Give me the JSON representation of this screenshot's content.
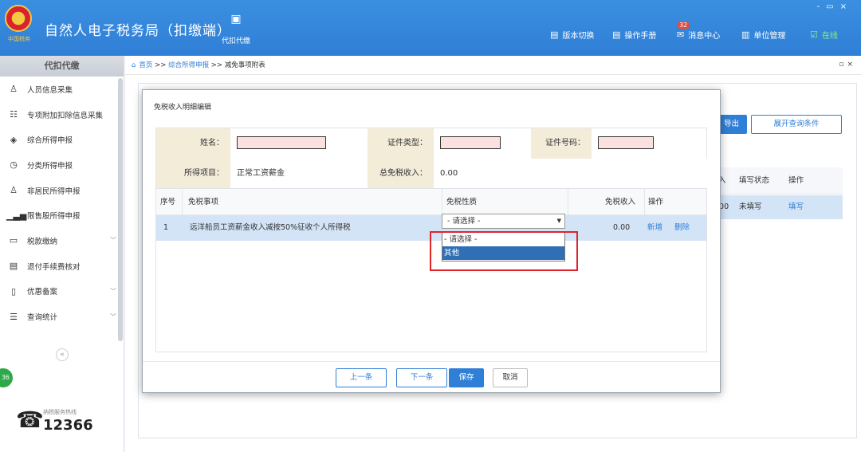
{
  "app": {
    "title": "自然人电子税务局（扣缴端）",
    "emblem_text": "中国税务",
    "top_tool": {
      "label": "代扣代缴",
      "icon": "wallet-icon"
    },
    "nav": [
      {
        "label": "版本切换",
        "icon": "document-icon"
      },
      {
        "label": "操作手册",
        "icon": "document-icon"
      },
      {
        "label": "消息中心",
        "icon": "mail-icon",
        "badge": "32"
      },
      {
        "label": "单位管理",
        "icon": "building-icon"
      },
      {
        "label": "在线",
        "icon": "online-icon"
      }
    ],
    "window_controls": [
      "-",
      "▭",
      "×"
    ]
  },
  "sidebar": {
    "title": "代扣代缴",
    "items": [
      {
        "label": "人员信息采集",
        "icon": "person-icon"
      },
      {
        "label": "专项附加扣除信息采集",
        "icon": "list-icon"
      },
      {
        "label": "综合所得申报",
        "icon": "layers-icon"
      },
      {
        "label": "分类所得申报",
        "icon": "clock-icon"
      },
      {
        "label": "非居民所得申报",
        "icon": "person-icon"
      },
      {
        "label": "限售股所得申报",
        "icon": "bar-chart-icon"
      },
      {
        "label": "税款缴纳",
        "icon": "folder-icon",
        "expandable": true
      },
      {
        "label": "退付手续费核对",
        "icon": "form-icon"
      },
      {
        "label": "优惠备案",
        "icon": "file-icon",
        "expandable": true
      },
      {
        "label": "查询统计",
        "icon": "search-list-icon",
        "expandable": true
      }
    ],
    "collapse_glyph": "«",
    "badge": "36",
    "hotline": {
      "label": "纳税服务热线",
      "number": "12366"
    }
  },
  "breadcrumb": {
    "home": "首页",
    "sep": ">>",
    "level1": "综合所得申报",
    "level2": "减免事项附表"
  },
  "background": {
    "export_btn": "导出",
    "expand_btn": "展开查询条件",
    "headers": {
      "income": "入",
      "status": "填写状态",
      "ops": "操作"
    },
    "row": {
      "income": ".00",
      "status": "未填写",
      "op": "填写"
    }
  },
  "modal": {
    "title": "免税收入明细编辑",
    "labels": {
      "name": "姓名：",
      "id_type": "证件类型：",
      "id_number": "证件号码：",
      "income_item": "所得项目：",
      "total_exempt": "总免税收入："
    },
    "values": {
      "income_item": "正常工资薪金",
      "total_exempt": "0.00"
    },
    "columns": [
      "序号",
      "免税事项",
      "免税性质",
      "免税收入",
      "操作"
    ],
    "rows": [
      {
        "seq": "1",
        "item": "远洋船员工资薪金收入减按50%征收个人所得税",
        "nature": "- 请选择 -",
        "income": "0.00",
        "add": "新增",
        "delete": "删除"
      }
    ],
    "dropdown_options": [
      "- 请选择 -",
      "其他"
    ],
    "buttons": {
      "prev": "上一条",
      "next": "下一条",
      "save": "保存",
      "cancel": "取消"
    }
  },
  "colors": {
    "brand_blue": "#2f7fd6",
    "highlight_red": "#e0242a",
    "selected_row": "#d3e4f7",
    "label_bg": "#f3ecd9"
  }
}
